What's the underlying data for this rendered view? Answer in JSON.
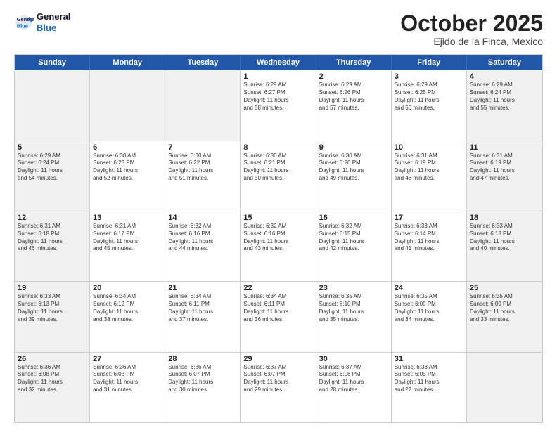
{
  "header": {
    "logo_line1": "General",
    "logo_line2": "Blue",
    "month": "October 2025",
    "location": "Ejido de la Finca, Mexico"
  },
  "weekdays": [
    "Sunday",
    "Monday",
    "Tuesday",
    "Wednesday",
    "Thursday",
    "Friday",
    "Saturday"
  ],
  "rows": [
    [
      {
        "day": "",
        "info": "",
        "shaded": true
      },
      {
        "day": "",
        "info": "",
        "shaded": true
      },
      {
        "day": "",
        "info": "",
        "shaded": true
      },
      {
        "day": "1",
        "info": "Sunrise: 6:29 AM\nSunset: 6:27 PM\nDaylight: 11 hours\nand 58 minutes.",
        "shaded": false
      },
      {
        "day": "2",
        "info": "Sunrise: 6:29 AM\nSunset: 6:26 PM\nDaylight: 11 hours\nand 57 minutes.",
        "shaded": false
      },
      {
        "day": "3",
        "info": "Sunrise: 6:29 AM\nSunset: 6:25 PM\nDaylight: 11 hours\nand 56 minutes.",
        "shaded": false
      },
      {
        "day": "4",
        "info": "Sunrise: 6:29 AM\nSunset: 6:24 PM\nDaylight: 11 hours\nand 55 minutes.",
        "shaded": true
      }
    ],
    [
      {
        "day": "5",
        "info": "Sunrise: 6:29 AM\nSunset: 6:24 PM\nDaylight: 11 hours\nand 54 minutes.",
        "shaded": true
      },
      {
        "day": "6",
        "info": "Sunrise: 6:30 AM\nSunset: 6:23 PM\nDaylight: 11 hours\nand 52 minutes.",
        "shaded": false
      },
      {
        "day": "7",
        "info": "Sunrise: 6:30 AM\nSunset: 6:22 PM\nDaylight: 11 hours\nand 51 minutes.",
        "shaded": false
      },
      {
        "day": "8",
        "info": "Sunrise: 6:30 AM\nSunset: 6:21 PM\nDaylight: 11 hours\nand 50 minutes.",
        "shaded": false
      },
      {
        "day": "9",
        "info": "Sunrise: 6:30 AM\nSunset: 6:20 PM\nDaylight: 11 hours\nand 49 minutes.",
        "shaded": false
      },
      {
        "day": "10",
        "info": "Sunrise: 6:31 AM\nSunset: 6:19 PM\nDaylight: 11 hours\nand 48 minutes.",
        "shaded": false
      },
      {
        "day": "11",
        "info": "Sunrise: 6:31 AM\nSunset: 6:19 PM\nDaylight: 11 hours\nand 47 minutes.",
        "shaded": true
      }
    ],
    [
      {
        "day": "12",
        "info": "Sunrise: 6:31 AM\nSunset: 6:18 PM\nDaylight: 11 hours\nand 46 minutes.",
        "shaded": true
      },
      {
        "day": "13",
        "info": "Sunrise: 6:31 AM\nSunset: 6:17 PM\nDaylight: 11 hours\nand 45 minutes.",
        "shaded": false
      },
      {
        "day": "14",
        "info": "Sunrise: 6:32 AM\nSunset: 6:16 PM\nDaylight: 11 hours\nand 44 minutes.",
        "shaded": false
      },
      {
        "day": "15",
        "info": "Sunrise: 6:32 AM\nSunset: 6:16 PM\nDaylight: 11 hours\nand 43 minutes.",
        "shaded": false
      },
      {
        "day": "16",
        "info": "Sunrise: 6:32 AM\nSunset: 6:15 PM\nDaylight: 11 hours\nand 42 minutes.",
        "shaded": false
      },
      {
        "day": "17",
        "info": "Sunrise: 6:33 AM\nSunset: 6:14 PM\nDaylight: 11 hours\nand 41 minutes.",
        "shaded": false
      },
      {
        "day": "18",
        "info": "Sunrise: 6:33 AM\nSunset: 6:13 PM\nDaylight: 11 hours\nand 40 minutes.",
        "shaded": true
      }
    ],
    [
      {
        "day": "19",
        "info": "Sunrise: 6:33 AM\nSunset: 6:13 PM\nDaylight: 11 hours\nand 39 minutes.",
        "shaded": true
      },
      {
        "day": "20",
        "info": "Sunrise: 6:34 AM\nSunset: 6:12 PM\nDaylight: 11 hours\nand 38 minutes.",
        "shaded": false
      },
      {
        "day": "21",
        "info": "Sunrise: 6:34 AM\nSunset: 6:11 PM\nDaylight: 11 hours\nand 37 minutes.",
        "shaded": false
      },
      {
        "day": "22",
        "info": "Sunrise: 6:34 AM\nSunset: 6:11 PM\nDaylight: 11 hours\nand 36 minutes.",
        "shaded": false
      },
      {
        "day": "23",
        "info": "Sunrise: 6:35 AM\nSunset: 6:10 PM\nDaylight: 11 hours\nand 35 minutes.",
        "shaded": false
      },
      {
        "day": "24",
        "info": "Sunrise: 6:35 AM\nSunset: 6:09 PM\nDaylight: 11 hours\nand 34 minutes.",
        "shaded": false
      },
      {
        "day": "25",
        "info": "Sunrise: 6:35 AM\nSunset: 6:09 PM\nDaylight: 11 hours\nand 33 minutes.",
        "shaded": true
      }
    ],
    [
      {
        "day": "26",
        "info": "Sunrise: 6:36 AM\nSunset: 6:08 PM\nDaylight: 11 hours\nand 32 minutes.",
        "shaded": true
      },
      {
        "day": "27",
        "info": "Sunrise: 6:36 AM\nSunset: 6:08 PM\nDaylight: 11 hours\nand 31 minutes.",
        "shaded": false
      },
      {
        "day": "28",
        "info": "Sunrise: 6:36 AM\nSunset: 6:07 PM\nDaylight: 11 hours\nand 30 minutes.",
        "shaded": false
      },
      {
        "day": "29",
        "info": "Sunrise: 6:37 AM\nSunset: 6:07 PM\nDaylight: 11 hours\nand 29 minutes.",
        "shaded": false
      },
      {
        "day": "30",
        "info": "Sunrise: 6:37 AM\nSunset: 6:06 PM\nDaylight: 11 hours\nand 28 minutes.",
        "shaded": false
      },
      {
        "day": "31",
        "info": "Sunrise: 6:38 AM\nSunset: 6:05 PM\nDaylight: 11 hours\nand 27 minutes.",
        "shaded": false
      },
      {
        "day": "",
        "info": "",
        "shaded": true
      }
    ]
  ]
}
